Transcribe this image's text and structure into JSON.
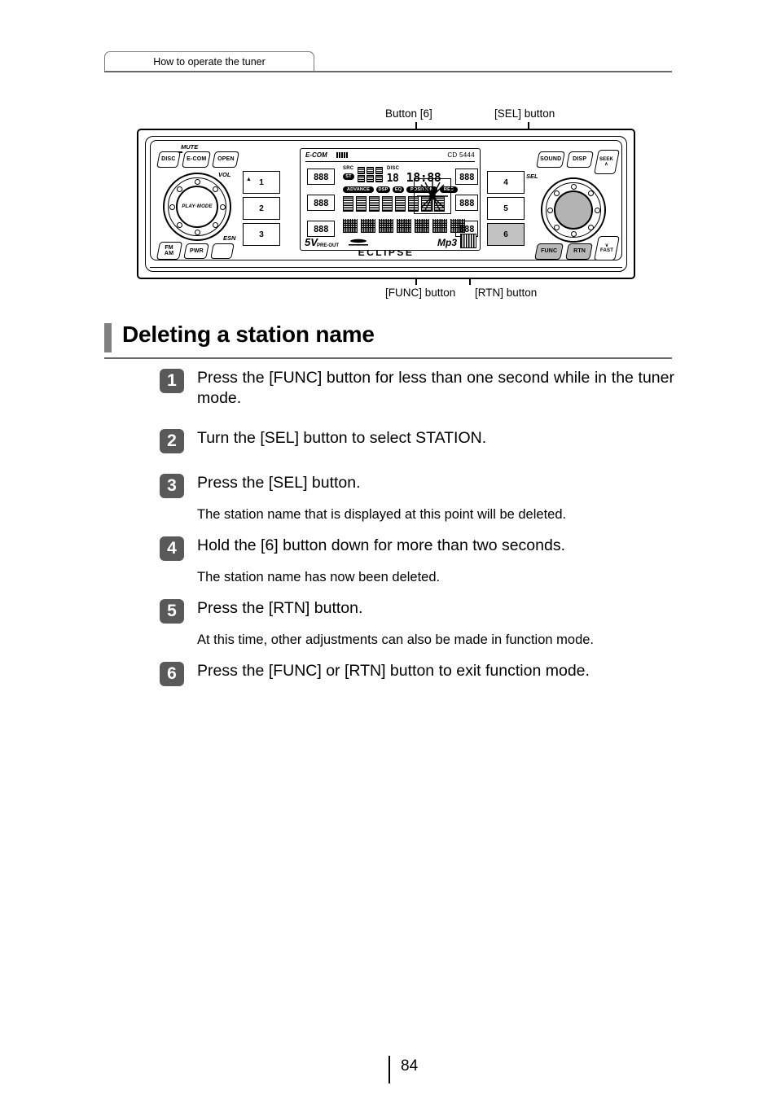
{
  "header": {
    "tab_label": "How to operate the tuner"
  },
  "diagram": {
    "callouts": {
      "top_left": "Button [6]",
      "top_right": "[SEL] button",
      "bottom_left": "[FUNC] button",
      "bottom_right": "[RTN] button"
    },
    "device": {
      "brand": "ECLIPSE",
      "model": "CD 5444",
      "left_keys": [
        {
          "label": "DISC"
        },
        {
          "label": "E-COM"
        },
        {
          "label": "OPEN"
        },
        {
          "label": "FM AM"
        },
        {
          "label": "PWR"
        }
      ],
      "right_keys": [
        {
          "label": "SOUND"
        },
        {
          "label": "DISP"
        },
        {
          "label": "SEEK"
        },
        {
          "label": "FUNC"
        },
        {
          "label": "RTN"
        },
        {
          "label": "FAST"
        }
      ],
      "left_knob": {
        "top_label": "MUTE",
        "side_label": "VOL",
        "hub_text": "PLAY·MODE",
        "bottom_label": "ESN"
      },
      "right_knob": {
        "side_label": "SEL"
      },
      "presets_left": [
        "1",
        "2",
        "3"
      ],
      "presets_right": [
        "4",
        "5",
        "6"
      ],
      "highlighted_preset": "6",
      "seek_up_glyph": "∧",
      "fast_down_glyph": "∨",
      "eject_glyph": "▲"
    },
    "lcd": {
      "logo": "E-COM",
      "model": "CD 5444",
      "src_label": "SRC",
      "st_label": "ST",
      "disc_label": "DISC",
      "disc_digit": "18",
      "clock": "18:88",
      "left_segments": [
        "888",
        "888",
        "888"
      ],
      "right_segments": [
        "888",
        "888",
        "888"
      ],
      "indicators": [
        "ADVANCE",
        "DSP",
        "EQ",
        "POSITION",
        "REC"
      ],
      "pre_out_voltage": "5V",
      "pre_out_label": "PRE-OUT",
      "format_label": "Mp3"
    }
  },
  "title": {
    "text": "Deleting a station name",
    "accent_color": "#808080"
  },
  "steps": [
    {
      "number": "1",
      "text": "Press the [FUNC] button for less than one second while in the tuner mode.",
      "note": null
    },
    {
      "number": "2",
      "text": "Turn the [SEL] button to select STATION.",
      "note": null
    },
    {
      "number": "3",
      "text": "Press the [SEL] button.",
      "note": "The station name that is displayed at this point will be deleted."
    },
    {
      "number": "4",
      "text": "Hold the [6] button down for more than two seconds.",
      "note": "The station name has now been deleted."
    },
    {
      "number": "5",
      "text": "Press the [RTN] button.",
      "note": "At this time, other adjustments can also be made in function mode."
    },
    {
      "number": "6",
      "text": "Press the [FUNC] or [RTN] button to exit function mode.",
      "note": null
    }
  ],
  "footer": {
    "page_number": "84"
  }
}
